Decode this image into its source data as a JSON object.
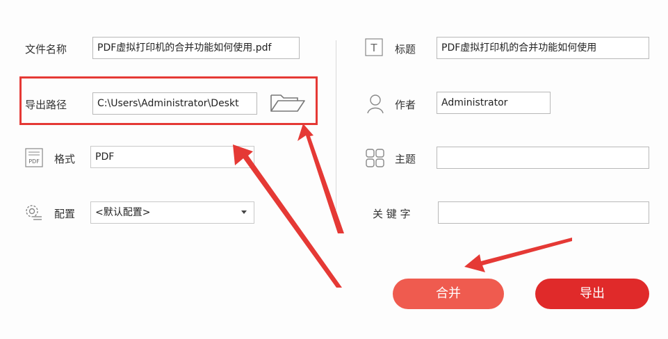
{
  "left": {
    "filename_label": "文件名称",
    "filename_value": "PDF虚拟打印机的合并功能如何使用.pdf",
    "export_path_label": "导出路径",
    "export_path_value": "C:\\Users\\Administrator\\Deskt",
    "format_label": "格式",
    "format_value": "PDF",
    "config_label": "配置",
    "config_value": "<默认配置>"
  },
  "right": {
    "title_label": "标题",
    "title_value": "PDF虚拟打印机的合并功能如何使用",
    "author_label": "作者",
    "author_value": "Administrator",
    "subject_label": "主题",
    "subject_value": "",
    "keywords_label": "关 键 字",
    "keywords_value": ""
  },
  "buttons": {
    "merge_label": "合并",
    "export_label": "导出"
  },
  "icons": {
    "pdf_icon_text": "PDF",
    "title_icon_text": "T"
  },
  "colors": {
    "merge_button": "#ef5b4f",
    "export_button": "#e02a2a",
    "annotation_red": "#e53935"
  }
}
